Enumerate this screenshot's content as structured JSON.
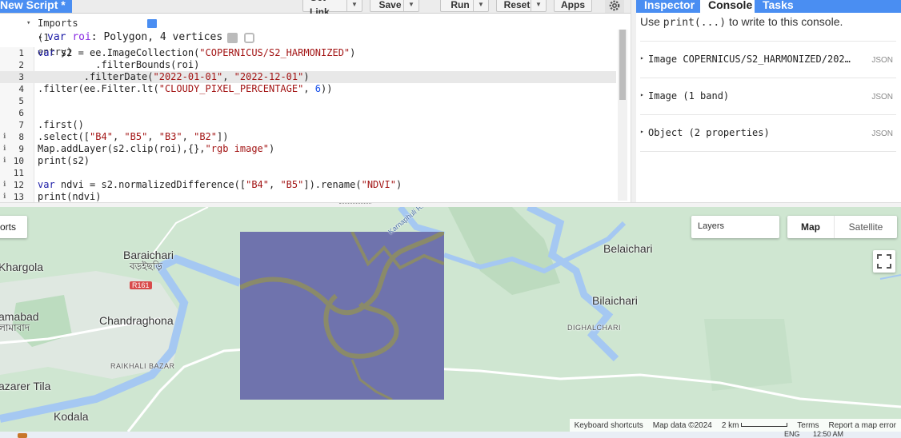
{
  "toolbar": {
    "script_title": "New Script *",
    "get_link": "Get Link",
    "save": "Save",
    "run": "Run",
    "reset": "Reset",
    "apps": "Apps"
  },
  "editor": {
    "imports_header": "Imports (1 entry)",
    "import_var_kw": "var",
    "import_var_name": "roi",
    "import_var_desc": ": Polygon, 4 vertices",
    "lines": [
      {
        "num": "1",
        "parts": [
          [
            "kw",
            "var"
          ],
          [
            "",
            "s2 = ee.ImageCollection("
          ],
          [
            "str",
            "\"COPERNICUS/S2_HARMONIZED\""
          ],
          [
            "",
            ")"
          ]
        ]
      },
      {
        "num": "2",
        "parts": [
          [
            "",
            "          .filterBounds(roi)"
          ]
        ]
      },
      {
        "num": "3",
        "parts": [
          [
            "",
            "        .filterDate("
          ],
          [
            "str",
            "\"2022-01-01\""
          ],
          [
            "",
            ", "
          ],
          [
            "str",
            "\"2022-12-01\""
          ],
          [
            "",
            ")"
          ]
        ]
      },
      {
        "num": "4",
        "parts": [
          [
            "",
            ".filter(ee.Filter.lt("
          ],
          [
            "str",
            "\"CLOUDY_PIXEL_PERCENTAGE\""
          ],
          [
            "",
            ", "
          ],
          [
            "num",
            "6"
          ],
          [
            "",
            "))"
          ]
        ]
      },
      {
        "num": "5",
        "parts": []
      },
      {
        "num": "6",
        "parts": []
      },
      {
        "num": "7",
        "parts": [
          [
            "",
            ".first()"
          ]
        ]
      },
      {
        "num": "8",
        "parts": [
          [
            "",
            ".select(["
          ],
          [
            "str",
            "\"B4\""
          ],
          [
            "",
            ", "
          ],
          [
            "str",
            "\"B5\""
          ],
          [
            "",
            ", "
          ],
          [
            "str",
            "\"B3\""
          ],
          [
            "",
            ", "
          ],
          [
            "str",
            "\"B2\""
          ],
          [
            "",
            "])"
          ]
        ]
      },
      {
        "num": "9",
        "parts": [
          [
            "",
            "Map.addLayer(s2.clip(roi),{},"
          ],
          [
            "str",
            "\"rgb image\""
          ],
          [
            "",
            ")"
          ]
        ]
      },
      {
        "num": "10",
        "parts": [
          [
            "",
            "print(s2)"
          ]
        ]
      },
      {
        "num": "11",
        "parts": []
      },
      {
        "num": "12",
        "parts": [
          [
            "kw",
            "var"
          ],
          [
            "",
            "ndvi = s2.normalizedDifference(["
          ],
          [
            "str",
            "\"B4\""
          ],
          [
            "",
            ", "
          ],
          [
            "str",
            "\"B5\""
          ],
          [
            "",
            "]).rename("
          ],
          [
            "str",
            "\"NDVI\""
          ],
          [
            "",
            ")"
          ]
        ]
      },
      {
        "num": "13",
        "parts": [
          [
            "",
            "print(ndvi)"
          ]
        ]
      }
    ]
  },
  "right_panel": {
    "tabs": [
      "Inspector",
      "Console",
      "Tasks"
    ],
    "active_tab": "Console",
    "hint_pre": "Use ",
    "hint_code": "print(...)",
    "hint_post": " to write to this console.",
    "entries": [
      {
        "text": "Image COPERNICUS/S2_HARMONIZED/202…",
        "json": "JSON"
      },
      {
        "text": "Image (1 band)",
        "json": "JSON"
      },
      {
        "text": "Object (2 properties)",
        "json": "JSON"
      }
    ]
  },
  "map": {
    "layers_label": "Layers",
    "map_type": "Map",
    "satellite": "Satellite",
    "imports_stub": "orts",
    "places": {
      "khargola": "Khargola",
      "baraichari": "Baraichari",
      "baraichari_bn": "বড়ইছড়ি",
      "r161": "R161",
      "amabad": "amabad",
      "amabad_bn": "লামাবাদ",
      "chandraghona": "Chandraghona",
      "raikhali": "RAIKHALI BAZAR",
      "azarer": "azarer Tila",
      "kodala": "Kodala",
      "belaichari": "Belaichari",
      "bilaichari": "Bilaichari",
      "dighalchari": "DIGHALCHARI",
      "river": "Karnaphuli Ri"
    },
    "footer": {
      "shortcuts": "Keyboard shortcuts",
      "map_data": "Map data ©2024",
      "scale": "2 km",
      "terms": "Terms",
      "report": "Report a map error"
    }
  },
  "taskbar": {
    "lang": "ENG",
    "time": "12:50 AM"
  }
}
